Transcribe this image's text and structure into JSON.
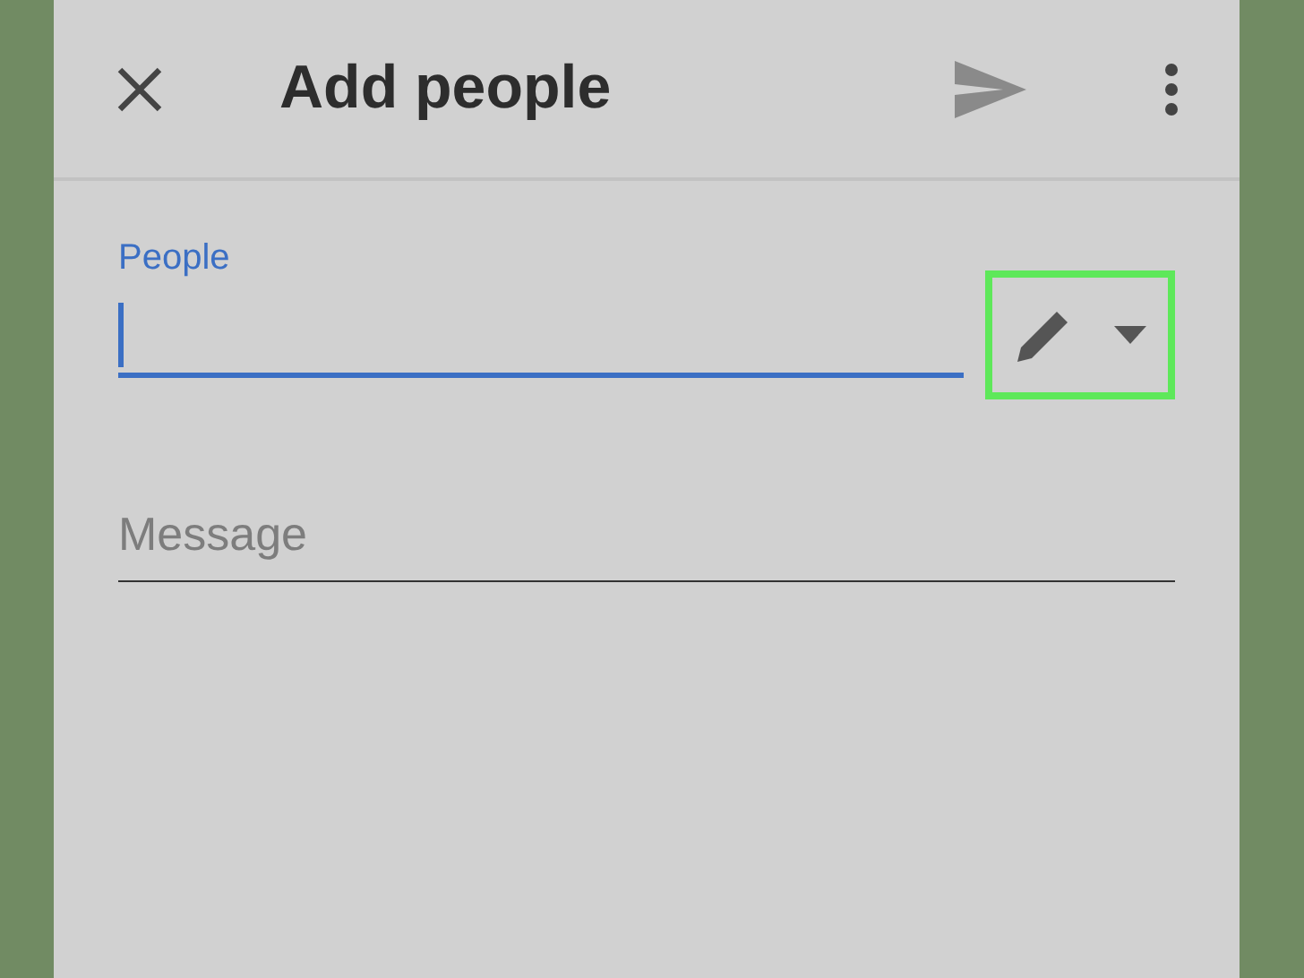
{
  "header": {
    "title": "Add people"
  },
  "people_field": {
    "label": "People",
    "focused": true
  },
  "access_button": {
    "highlighted": true
  },
  "message_field": {
    "placeholder": "Message"
  }
}
